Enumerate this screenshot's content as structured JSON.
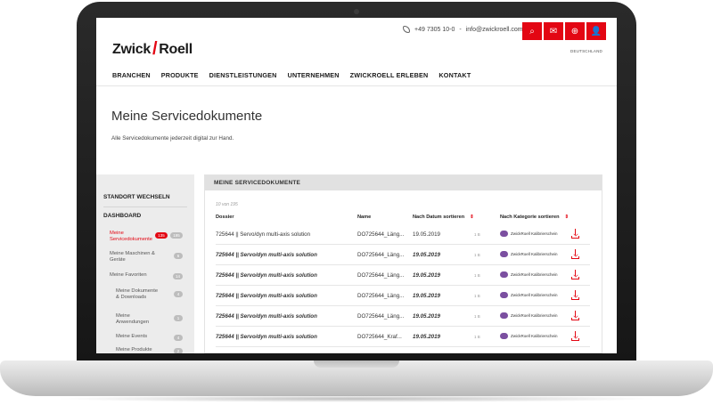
{
  "brand": {
    "part1": "Zwick",
    "part2": "Roell",
    "accent": "#e30613"
  },
  "contact": {
    "phone": "+49 7305 10-0",
    "separator": "-",
    "email": "info@zwickroell.com"
  },
  "top_icons": [
    {
      "name": "search-icon",
      "glyph": "⌕"
    },
    {
      "name": "mail-icon",
      "glyph": "✉"
    },
    {
      "name": "globe-icon",
      "glyph": "⊕"
    },
    {
      "name": "user-icon",
      "glyph": "👤"
    }
  ],
  "country": "DEUTSCHLAND",
  "nav": [
    "BRANCHEN",
    "PRODUKTE",
    "DIENSTLEISTUNGEN",
    "UNTERNEHMEN",
    "ZWICKROELL ERLEBEN",
    "KONTAKT"
  ],
  "page": {
    "title": "Meine Servicedokumente",
    "subtitle": "Alle Servicedokumente jederzeit digital zur Hand."
  },
  "sidebar": {
    "change_location": "STANDORT WECHSELN",
    "dashboard": "DASHBOARD",
    "items": [
      {
        "label": "Meine Servicedokumente",
        "badges": [
          "135",
          "195"
        ]
      },
      {
        "label": "Meine Maschinen & Geräte",
        "badges": [
          "6"
        ]
      },
      {
        "label": "Meine Favoriten",
        "badges": [
          "14"
        ]
      },
      {
        "label": "Meine Dokumente & Downloads",
        "badges": [
          "4"
        ]
      },
      {
        "label": "Meine Anwendungen",
        "badges": [
          "1"
        ]
      },
      {
        "label": "Meine Events",
        "badges": [
          "4"
        ]
      },
      {
        "label": "Meine Produkte",
        "badges": [
          "2"
        ]
      }
    ]
  },
  "main": {
    "header": "MEINE SERVICEDOKUMENTE",
    "count": "10 von 195",
    "columns": {
      "dossier": "Dossier",
      "name": "Name",
      "date": "Nach Datum sortieren",
      "date_arrow": "⇕",
      "category": "Nach Kategorie sortieren",
      "category_arrow": "⇕"
    },
    "rows": [
      {
        "dossier": "725644 || Servo/dyn multi-axis solution",
        "name": "DO725644_Läng...",
        "date": "19.05.2019",
        "size": "1 B",
        "category": "ZwickRoell Kalibrierschein"
      },
      {
        "dossier": "725644 || Servo/dyn multi-axis solution",
        "name": "DO725644_Läng...",
        "date": "19.05.2019",
        "size": "1 B",
        "category": "ZwickRoell Kalibrierschein"
      },
      {
        "dossier": "725644 || Servo/dyn multi-axis solution",
        "name": "DO725644_Läng...",
        "date": "19.05.2019",
        "size": "1 B",
        "category": "ZwickRoell Kalibrierschein"
      },
      {
        "dossier": "725644 || Servo/dyn multi-axis solution",
        "name": "DO725644_Läng...",
        "date": "19.05.2019",
        "size": "1 B",
        "category": "ZwickRoell Kalibrierschein"
      },
      {
        "dossier": "725644 || Servo/dyn multi-axis solution",
        "name": "DO725644_Läng...",
        "date": "19.05.2019",
        "size": "1 B",
        "category": "ZwickRoell Kalibrierschein"
      },
      {
        "dossier": "725644 || Servo/dyn multi-axis solution",
        "name": "DO725644_Kraf...",
        "date": "19.05.2019",
        "size": "1 B",
        "category": "ZwickRoell Kalibrierschein"
      }
    ]
  }
}
